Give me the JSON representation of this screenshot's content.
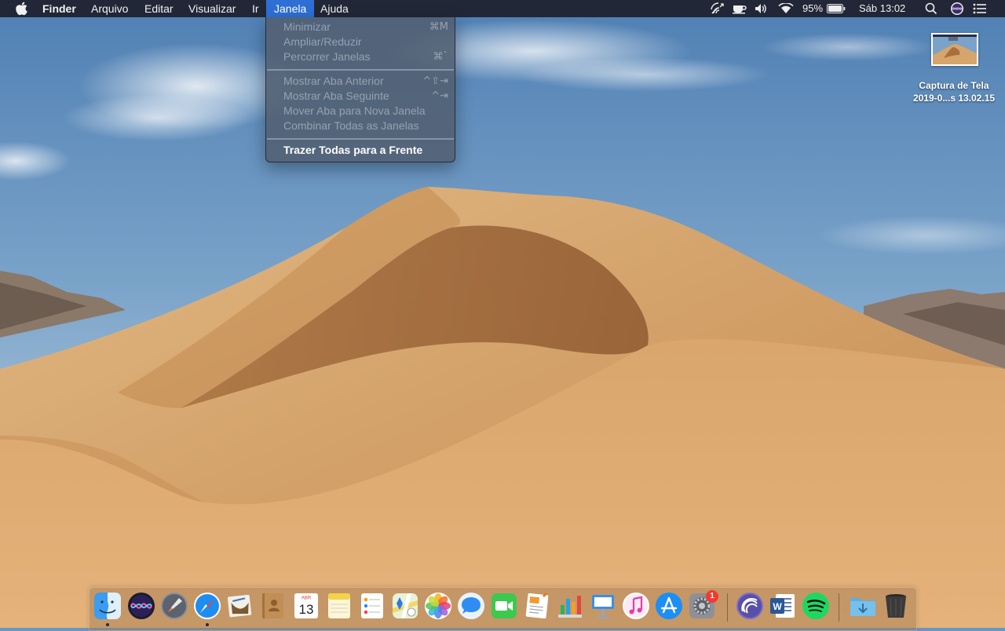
{
  "menubar": {
    "app_name": "Finder",
    "menus": [
      "Arquivo",
      "Editar",
      "Visualizar",
      "Ir",
      "Janela",
      "Ajuda"
    ],
    "active_menu": "Janela",
    "status": {
      "battery_percent": "95%",
      "clock": "Sáb 13:02"
    },
    "status_icons": [
      "airplay-icon",
      "coffee-icon",
      "volume-icon",
      "wifi-icon",
      "battery-icon",
      "spotlight-search-icon",
      "siri-icon",
      "notification-center-icon"
    ]
  },
  "window_menu": {
    "items": [
      {
        "label": "Minimizar",
        "shortcut": "⌘M",
        "enabled": false
      },
      {
        "label": "Ampliar/Reduzir",
        "shortcut": "",
        "enabled": false
      },
      {
        "label": "Percorrer Janelas",
        "shortcut": "⌘`",
        "enabled": false
      },
      {
        "label": "Mostrar Aba Anterior",
        "shortcut": "^⇧⇥",
        "enabled": false
      },
      {
        "label": "Mostrar Aba Seguinte",
        "shortcut": "^⇥",
        "enabled": false
      },
      {
        "label": "Mover Aba para Nova Janela",
        "shortcut": "",
        "enabled": false
      },
      {
        "label": "Combinar Todas as Janelas",
        "shortcut": "",
        "enabled": false
      },
      {
        "label": "Trazer Todas para a Frente",
        "shortcut": "",
        "enabled": true
      }
    ]
  },
  "desktop": {
    "file": {
      "name_line1": "Captura de Tela",
      "name_line2": "2019-0...s 13.02.15"
    }
  },
  "dock": {
    "apps": [
      {
        "name": "finder-icon",
        "running": true
      },
      {
        "name": "siri-icon",
        "running": false
      },
      {
        "name": "launchpad-icon",
        "running": false
      },
      {
        "name": "safari-icon",
        "running": true
      },
      {
        "name": "mail-icon",
        "running": false
      },
      {
        "name": "contacts-icon",
        "running": false
      },
      {
        "name": "calendar-icon",
        "running": false
      },
      {
        "name": "notes-icon",
        "running": false
      },
      {
        "name": "reminders-icon",
        "running": false
      },
      {
        "name": "maps-icon",
        "running": false
      },
      {
        "name": "photos-icon",
        "running": false
      },
      {
        "name": "messages-icon",
        "running": false
      },
      {
        "name": "facetime-icon",
        "running": false
      },
      {
        "name": "pages-icon",
        "running": false
      },
      {
        "name": "numbers-icon",
        "running": false
      },
      {
        "name": "keynote-icon",
        "running": false
      },
      {
        "name": "itunes-icon",
        "running": false
      },
      {
        "name": "app-store-icon",
        "running": false
      },
      {
        "name": "system-preferences-icon",
        "running": false
      },
      {
        "name": "qbittorrent-icon",
        "running": false
      },
      {
        "name": "word-icon",
        "running": false
      },
      {
        "name": "spotify-icon",
        "running": false
      },
      {
        "name": "downloads-folder-icon",
        "running": false
      },
      {
        "name": "trash-icon",
        "running": false
      }
    ],
    "calendar_month": "ABR",
    "calendar_day": "13",
    "system_preferences_badge": "1"
  },
  "colors": {
    "menu_highlight": "#2e6fd6",
    "sky": "#6c95bd",
    "sand": "#d4a56a",
    "badge": "#f23a30"
  }
}
